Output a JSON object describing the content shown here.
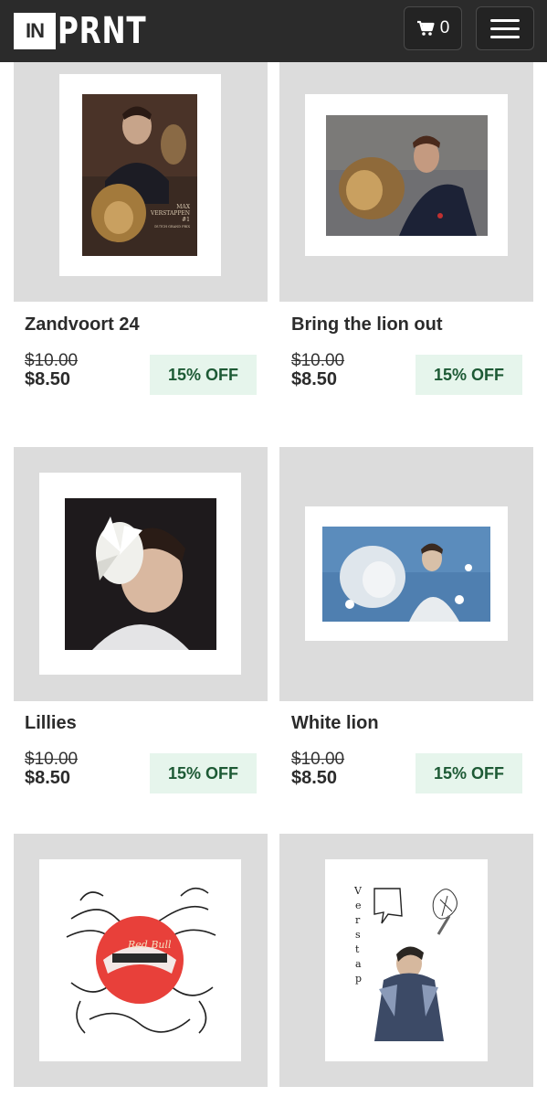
{
  "header": {
    "logo_box": "IN",
    "logo_text": "PRNT",
    "cart_count": "0",
    "cart_icon": "cart-icon",
    "menu_icon": "hamburger-menu-icon"
  },
  "products": [
    {
      "title": "Zandvoort 24",
      "old_price": "$10.00",
      "new_price": "$8.50",
      "badge": "15% OFF",
      "art_text": [
        "MAX",
        "VERSTAPPEN",
        "#1",
        "DUTCH GRAND PRIX"
      ]
    },
    {
      "title": "Bring the lion out",
      "old_price": "$10.00",
      "new_price": "$8.50",
      "badge": "15% OFF"
    },
    {
      "title": "Lillies",
      "old_price": "$10.00",
      "new_price": "$8.50",
      "badge": "15% OFF"
    },
    {
      "title": "White lion",
      "old_price": "$10.00",
      "new_price": "$8.50",
      "badge": "15% OFF"
    },
    {
      "title": "",
      "art_text": [
        "Red Bull"
      ]
    },
    {
      "title": "",
      "art_text": [
        "V",
        "e",
        "r",
        "s",
        "t",
        "a",
        "p"
      ]
    }
  ],
  "colors": {
    "header_bg": "#2b2b2b",
    "tile_bg": "#dcdcdc",
    "badge_bg": "#e6f5ec",
    "badge_text": "#1d5a35"
  }
}
